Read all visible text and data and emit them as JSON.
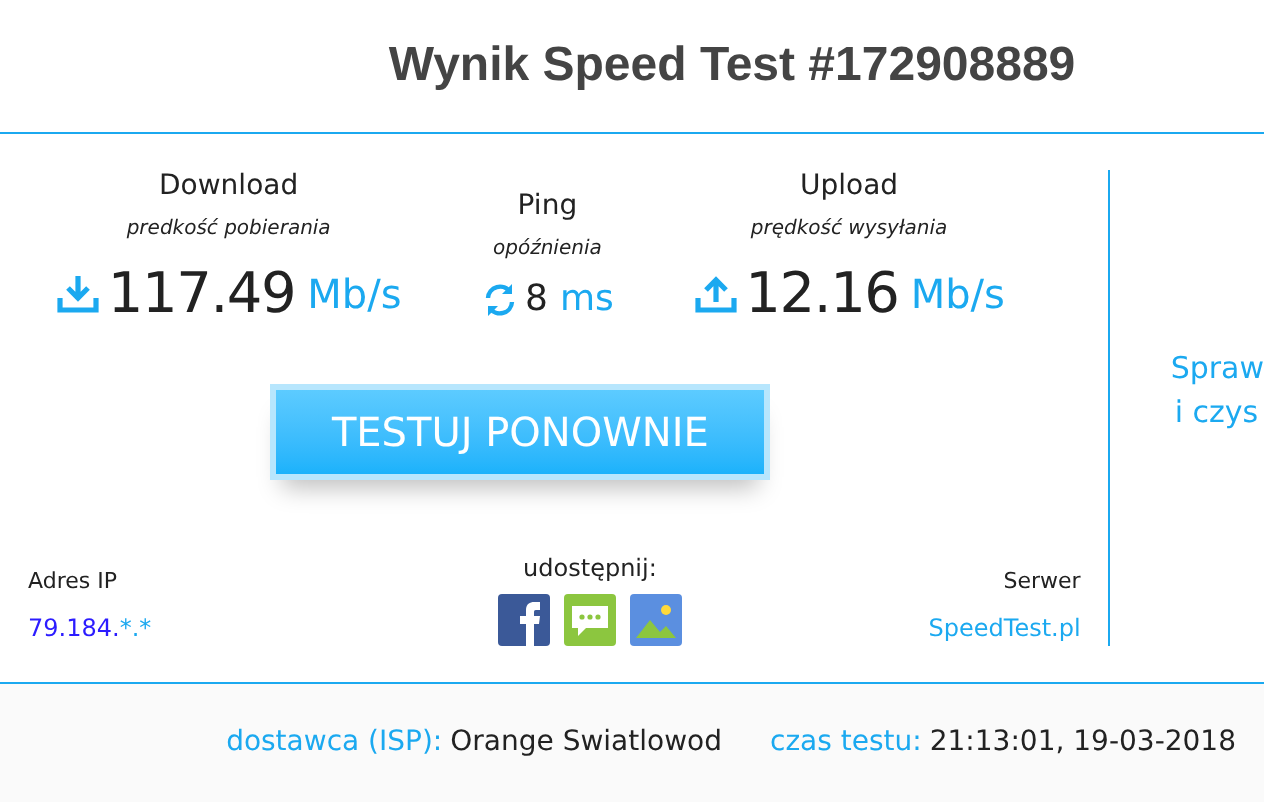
{
  "title": "Wynik Speed Test #172908889",
  "metrics": [
    {
      "kind": "download",
      "label": "Download",
      "sublabel": "predkość pobierania",
      "value": "117.49",
      "unit": "Mb/s"
    },
    {
      "kind": "ping",
      "label": "Ping",
      "sublabel": "opóźnienia",
      "value": "8",
      "unit": "ms"
    },
    {
      "kind": "upload",
      "label": "Upload",
      "sublabel": "prędkość wysyłania",
      "value": "12.16",
      "unit": "Mb/s"
    }
  ],
  "retest_button": "TESTUJ PONOWNIE",
  "ip": {
    "label": "Adres IP",
    "value": "79.184.",
    "masked": "*.*"
  },
  "share": {
    "label": "udostępnij:",
    "icons": [
      {
        "kind": "facebook"
      },
      {
        "kind": "message"
      },
      {
        "kind": "image"
      }
    ]
  },
  "server": {
    "label": "Serwer",
    "value": "SpeedTest.pl"
  },
  "side_text": [
    "Spraw",
    "i czys"
  ],
  "footer": {
    "isp_label": "dostawca (ISP):",
    "isp_value": "Orange Swiatlowod",
    "time_label": "czas testu:",
    "time_value": "21:13:01, 19-03-2018"
  }
}
